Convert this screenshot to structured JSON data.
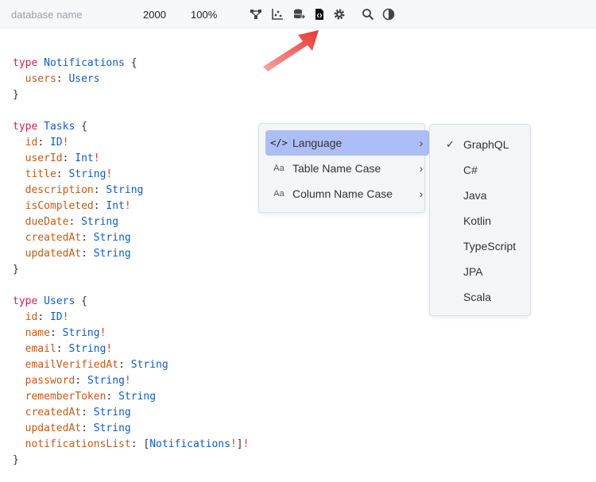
{
  "toolbar": {
    "db_name_placeholder": "database name",
    "canvas_size": "2000",
    "zoom": "100%",
    "icons": [
      "diagram-icon",
      "chart-icon",
      "database-export-icon",
      "code-file-icon",
      "gear-icon",
      "search-icon",
      "theme-toggle-icon"
    ]
  },
  "code": {
    "keyword": "type",
    "types": [
      {
        "name": "Notifications",
        "fields": [
          {
            "name": "users",
            "type": "Users",
            "required": false
          }
        ]
      },
      {
        "name": "Tasks",
        "fields": [
          {
            "name": "id",
            "type": "ID",
            "required": true
          },
          {
            "name": "userId",
            "type": "Int",
            "required": true
          },
          {
            "name": "title",
            "type": "String",
            "required": true
          },
          {
            "name": "description",
            "type": "String",
            "required": false
          },
          {
            "name": "isCompleted",
            "type": "Int",
            "required": true
          },
          {
            "name": "dueDate",
            "type": "String",
            "required": false
          },
          {
            "name": "createdAt",
            "type": "String",
            "required": false
          },
          {
            "name": "updatedAt",
            "type": "String",
            "required": false
          }
        ]
      },
      {
        "name": "Users",
        "fields": [
          {
            "name": "id",
            "type": "ID",
            "required": true
          },
          {
            "name": "name",
            "type": "String",
            "required": true
          },
          {
            "name": "email",
            "type": "String",
            "required": true
          },
          {
            "name": "emailVerifiedAt",
            "type": "String",
            "required": false
          },
          {
            "name": "password",
            "type": "String",
            "required": true
          },
          {
            "name": "rememberToken",
            "type": "String",
            "required": false
          },
          {
            "name": "createdAt",
            "type": "String",
            "required": false
          },
          {
            "name": "updatedAt",
            "type": "String",
            "required": false
          },
          {
            "name": "notificationsList",
            "type": "Notifications",
            "required": true,
            "list": true
          }
        ]
      }
    ]
  },
  "menu": {
    "items": [
      {
        "icon": "</>",
        "label": "Language",
        "active": true
      },
      {
        "icon": "Aa",
        "label": "Table Name Case",
        "active": false
      },
      {
        "icon": "Aa",
        "label": "Column Name Case",
        "active": false
      }
    ]
  },
  "language_submenu": {
    "selected": "GraphQL",
    "check": "✓",
    "options": [
      "GraphQL",
      "C#",
      "Java",
      "Kotlin",
      "TypeScript",
      "JPA",
      "Scala"
    ]
  },
  "colors": {
    "keyword": "#c8254f",
    "type_name": "#0f5cbf",
    "field": "#c05a16",
    "required_bang": "#d63a3a",
    "menu_active": "#adbdf5",
    "arrow": "#e53935"
  }
}
